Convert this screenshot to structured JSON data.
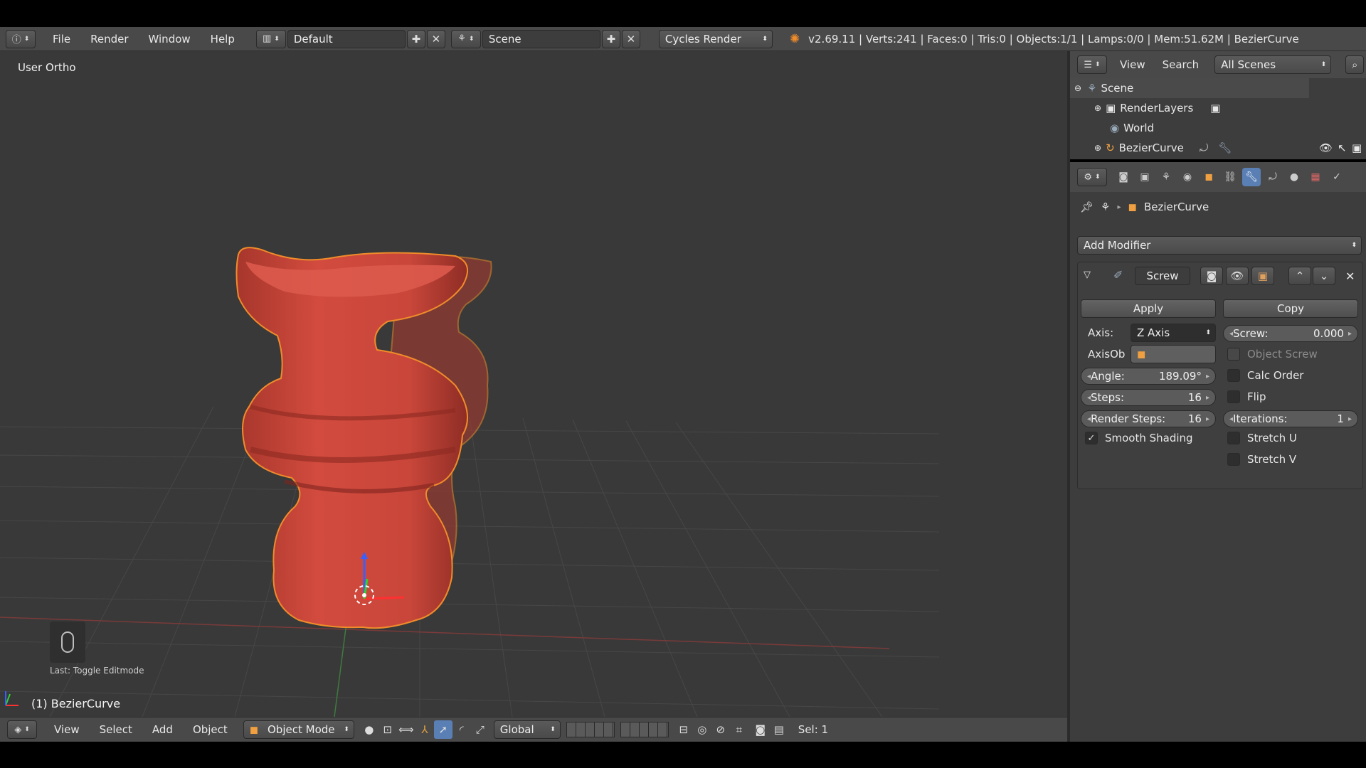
{
  "header": {
    "menu": [
      "File",
      "Render",
      "Window",
      "Help"
    ],
    "layout": "Default",
    "scene": "Scene",
    "engine": "Cycles Render",
    "status": "v2.69.11 | Verts:241 | Faces:0 | Tris:0 | Objects:1/1 | Lamps:0/0 | Mem:51.62M | BezierCurve"
  },
  "viewport": {
    "view_name": "User Ortho",
    "active_object": "(1) BezierCurve",
    "last_operator": "Last: Toggle Editmode"
  },
  "bottom_header": {
    "menu": [
      "View",
      "Select",
      "Add",
      "Object"
    ],
    "mode": "Object Mode",
    "orientation": "Global",
    "selection": "Sel: 1"
  },
  "outliner": {
    "menu": [
      "View",
      "Search"
    ],
    "filter": "All Scenes",
    "items": [
      {
        "label": "Scene"
      },
      {
        "label": "RenderLayers"
      },
      {
        "label": "World"
      },
      {
        "label": "BezierCurve"
      }
    ]
  },
  "properties": {
    "breadcrumb_object": "BezierCurve",
    "add_modifier_label": "Add Modifier",
    "modifier_name": "Screw",
    "apply_label": "Apply",
    "copy_label": "Copy",
    "axis_label": "Axis:",
    "axis_value": "Z Axis",
    "axisob_label": "AxisOb",
    "screw_label": "Screw:",
    "screw_value": "0.000",
    "object_screw_label": "Object Screw",
    "angle_label": "Angle:",
    "angle_value": "189.09°",
    "calc_order_label": "Calc Order",
    "steps_label": "Steps:",
    "steps_value": "16",
    "flip_label": "Flip",
    "render_steps_label": "Render Steps:",
    "render_steps_value": "16",
    "iterations_label": "Iterations:",
    "iterations_value": "1",
    "smooth_shading_label": "Smooth Shading",
    "smooth_shading_checked": true,
    "stretch_u_label": "Stretch U",
    "stretch_v_label": "Stretch V"
  },
  "colors": {
    "object_red": "#c9463a",
    "selection_orange": "#f08c2a",
    "active_blue": "#5a7fb5"
  }
}
